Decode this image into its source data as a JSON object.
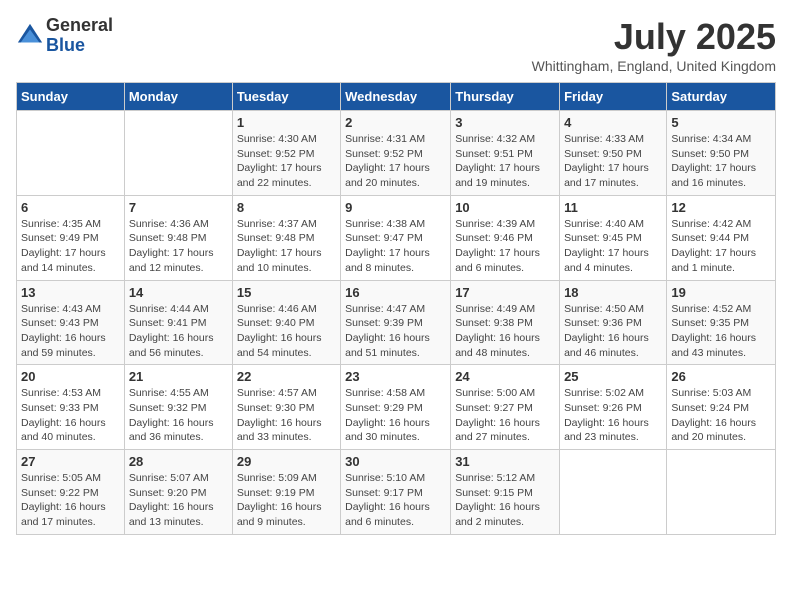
{
  "logo": {
    "general": "General",
    "blue": "Blue"
  },
  "title": "July 2025",
  "location": "Whittingham, England, United Kingdom",
  "days_of_week": [
    "Sunday",
    "Monday",
    "Tuesday",
    "Wednesday",
    "Thursday",
    "Friday",
    "Saturday"
  ],
  "weeks": [
    [
      {
        "day": "",
        "info": ""
      },
      {
        "day": "",
        "info": ""
      },
      {
        "day": "1",
        "info": "Sunrise: 4:30 AM\nSunset: 9:52 PM\nDaylight: 17 hours and 22 minutes."
      },
      {
        "day": "2",
        "info": "Sunrise: 4:31 AM\nSunset: 9:52 PM\nDaylight: 17 hours and 20 minutes."
      },
      {
        "day": "3",
        "info": "Sunrise: 4:32 AM\nSunset: 9:51 PM\nDaylight: 17 hours and 19 minutes."
      },
      {
        "day": "4",
        "info": "Sunrise: 4:33 AM\nSunset: 9:50 PM\nDaylight: 17 hours and 17 minutes."
      },
      {
        "day": "5",
        "info": "Sunrise: 4:34 AM\nSunset: 9:50 PM\nDaylight: 17 hours and 16 minutes."
      }
    ],
    [
      {
        "day": "6",
        "info": "Sunrise: 4:35 AM\nSunset: 9:49 PM\nDaylight: 17 hours and 14 minutes."
      },
      {
        "day": "7",
        "info": "Sunrise: 4:36 AM\nSunset: 9:48 PM\nDaylight: 17 hours and 12 minutes."
      },
      {
        "day": "8",
        "info": "Sunrise: 4:37 AM\nSunset: 9:48 PM\nDaylight: 17 hours and 10 minutes."
      },
      {
        "day": "9",
        "info": "Sunrise: 4:38 AM\nSunset: 9:47 PM\nDaylight: 17 hours and 8 minutes."
      },
      {
        "day": "10",
        "info": "Sunrise: 4:39 AM\nSunset: 9:46 PM\nDaylight: 17 hours and 6 minutes."
      },
      {
        "day": "11",
        "info": "Sunrise: 4:40 AM\nSunset: 9:45 PM\nDaylight: 17 hours and 4 minutes."
      },
      {
        "day": "12",
        "info": "Sunrise: 4:42 AM\nSunset: 9:44 PM\nDaylight: 17 hours and 1 minute."
      }
    ],
    [
      {
        "day": "13",
        "info": "Sunrise: 4:43 AM\nSunset: 9:43 PM\nDaylight: 16 hours and 59 minutes."
      },
      {
        "day": "14",
        "info": "Sunrise: 4:44 AM\nSunset: 9:41 PM\nDaylight: 16 hours and 56 minutes."
      },
      {
        "day": "15",
        "info": "Sunrise: 4:46 AM\nSunset: 9:40 PM\nDaylight: 16 hours and 54 minutes."
      },
      {
        "day": "16",
        "info": "Sunrise: 4:47 AM\nSunset: 9:39 PM\nDaylight: 16 hours and 51 minutes."
      },
      {
        "day": "17",
        "info": "Sunrise: 4:49 AM\nSunset: 9:38 PM\nDaylight: 16 hours and 48 minutes."
      },
      {
        "day": "18",
        "info": "Sunrise: 4:50 AM\nSunset: 9:36 PM\nDaylight: 16 hours and 46 minutes."
      },
      {
        "day": "19",
        "info": "Sunrise: 4:52 AM\nSunset: 9:35 PM\nDaylight: 16 hours and 43 minutes."
      }
    ],
    [
      {
        "day": "20",
        "info": "Sunrise: 4:53 AM\nSunset: 9:33 PM\nDaylight: 16 hours and 40 minutes."
      },
      {
        "day": "21",
        "info": "Sunrise: 4:55 AM\nSunset: 9:32 PM\nDaylight: 16 hours and 36 minutes."
      },
      {
        "day": "22",
        "info": "Sunrise: 4:57 AM\nSunset: 9:30 PM\nDaylight: 16 hours and 33 minutes."
      },
      {
        "day": "23",
        "info": "Sunrise: 4:58 AM\nSunset: 9:29 PM\nDaylight: 16 hours and 30 minutes."
      },
      {
        "day": "24",
        "info": "Sunrise: 5:00 AM\nSunset: 9:27 PM\nDaylight: 16 hours and 27 minutes."
      },
      {
        "day": "25",
        "info": "Sunrise: 5:02 AM\nSunset: 9:26 PM\nDaylight: 16 hours and 23 minutes."
      },
      {
        "day": "26",
        "info": "Sunrise: 5:03 AM\nSunset: 9:24 PM\nDaylight: 16 hours and 20 minutes."
      }
    ],
    [
      {
        "day": "27",
        "info": "Sunrise: 5:05 AM\nSunset: 9:22 PM\nDaylight: 16 hours and 17 minutes."
      },
      {
        "day": "28",
        "info": "Sunrise: 5:07 AM\nSunset: 9:20 PM\nDaylight: 16 hours and 13 minutes."
      },
      {
        "day": "29",
        "info": "Sunrise: 5:09 AM\nSunset: 9:19 PM\nDaylight: 16 hours and 9 minutes."
      },
      {
        "day": "30",
        "info": "Sunrise: 5:10 AM\nSunset: 9:17 PM\nDaylight: 16 hours and 6 minutes."
      },
      {
        "day": "31",
        "info": "Sunrise: 5:12 AM\nSunset: 9:15 PM\nDaylight: 16 hours and 2 minutes."
      },
      {
        "day": "",
        "info": ""
      },
      {
        "day": "",
        "info": ""
      }
    ]
  ]
}
